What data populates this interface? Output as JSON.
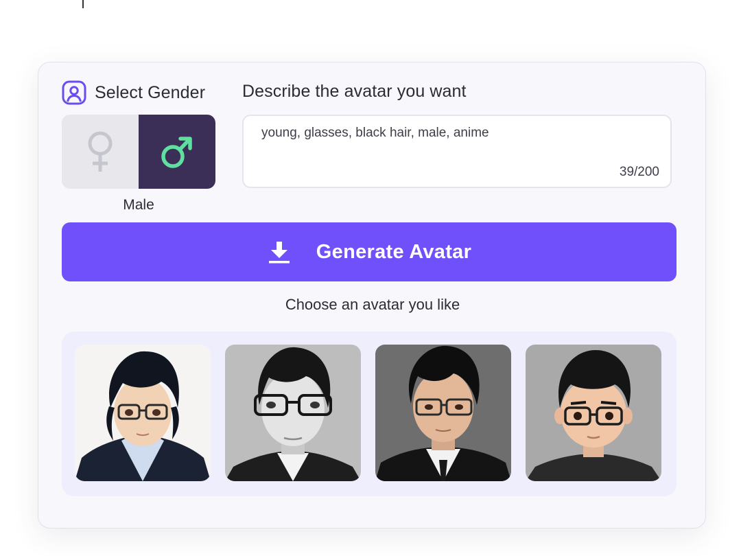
{
  "gender": {
    "heading": "Select Gender",
    "options": [
      {
        "name": "Female",
        "icon": "female-symbol-icon",
        "selected": false
      },
      {
        "name": "Male",
        "icon": "male-symbol-icon",
        "selected": true
      }
    ],
    "selected_label": "Male"
  },
  "description": {
    "heading": "Describe the avatar you want",
    "value": "young, glasses, black hair, male, anime",
    "counter": "39/200"
  },
  "generate": {
    "label": "Generate Avatar",
    "icon": "download-icon"
  },
  "gallery": {
    "caption": "Choose an avatar you like",
    "avatars": [
      {
        "style": "anime-color"
      },
      {
        "style": "grayscale-portrait"
      },
      {
        "style": "realistic-dark"
      },
      {
        "style": "3d-cartoon"
      }
    ]
  },
  "colors": {
    "accent": "#7050fb",
    "male_selected_bg": "#3b2f58",
    "male_symbol": "#5fe0a0",
    "female_unselected_bg": "#e7e7ec",
    "card_bg": "#f8f8fc",
    "gallery_bg": "#efeefc"
  }
}
